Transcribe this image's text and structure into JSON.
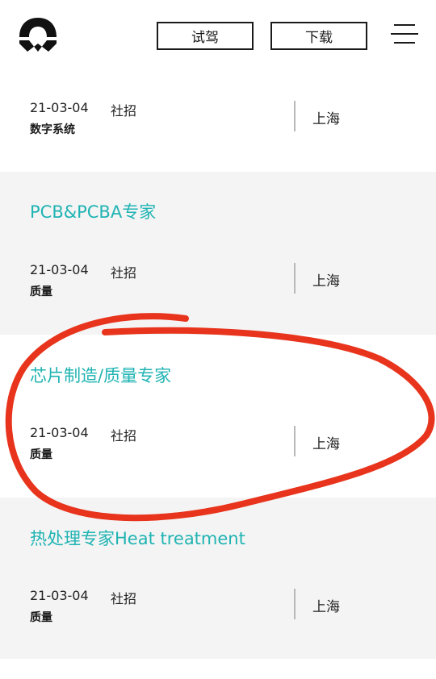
{
  "header": {
    "logo_icon": "nio-logo-icon",
    "test_drive_label": "试驾",
    "download_label": "下载",
    "menu_icon": "hamburger-menu-icon"
  },
  "jobs": [
    {
      "title": "",
      "date": "21-03-04",
      "type": "社招",
      "dept": "数字系统",
      "city": "上海"
    },
    {
      "title": "PCB&PCBA专家",
      "date": "21-03-04",
      "type": "社招",
      "dept": "质量",
      "city": "上海"
    },
    {
      "title": "芯片制造/质量专家",
      "date": "21-03-04",
      "type": "社招",
      "dept": "质量",
      "city": "上海"
    },
    {
      "title": "热处理专家Heat treatment",
      "date": "21-03-04",
      "type": "社招",
      "dept": "质量",
      "city": "上海"
    }
  ],
  "colors": {
    "title_teal": "#20b3b3",
    "card_grey": "#f4f4f4",
    "annotation_red": "#e8341c"
  }
}
